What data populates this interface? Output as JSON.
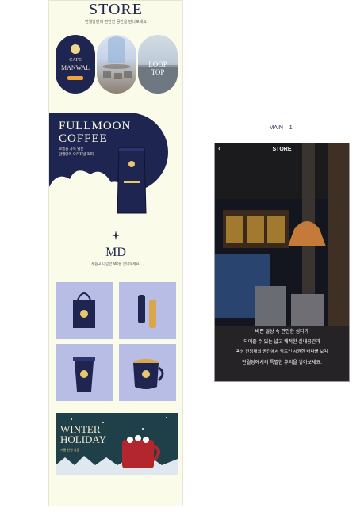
{
  "left_page": {
    "store_title": "STORE",
    "store_subtitle": "만월당만의 편안한 공간을 만나보세요",
    "cards": [
      {
        "line1": "CAFE",
        "line2": "MANWAL",
        "badge": ""
      },
      {
        "line1": "",
        "line2": "",
        "badge": ""
      },
      {
        "line1": "LOOP",
        "line2": "TOP",
        "badge": ""
      }
    ],
    "fullmoon": {
      "title_line1": "FULLMOON",
      "title_line2": "COFFEE",
      "desc_line1": "보름을 가득 담은",
      "desc_line2": "만월당의 오리지널 커피"
    },
    "md_title": "MD",
    "md_subtitle": "새롭고 다양한 MD를 만나보세요!",
    "banner": {
      "title_line1": "WINTER",
      "title_line2": "HOLIDAY",
      "sub_line1": "겨울 한정 상품"
    }
  },
  "main_label": "MAIN – 1",
  "phone": {
    "back": "‹",
    "title": "STORE",
    "lines": [
      "바쁜 일상 속 편안한 쉼터가",
      "되어줄 수 있는 넓고 쾌적한 실내공간과",
      "옥상 전망대의 공간에서 탁트인 시원한 바다를 보며",
      "만월당에서의 특별한 추억을 쌓아보세요."
    ]
  },
  "colors": {
    "navy": "#1e2550",
    "cream": "#fbfbea",
    "lilac": "#b8bde6",
    "amber": "#f0a53a"
  }
}
